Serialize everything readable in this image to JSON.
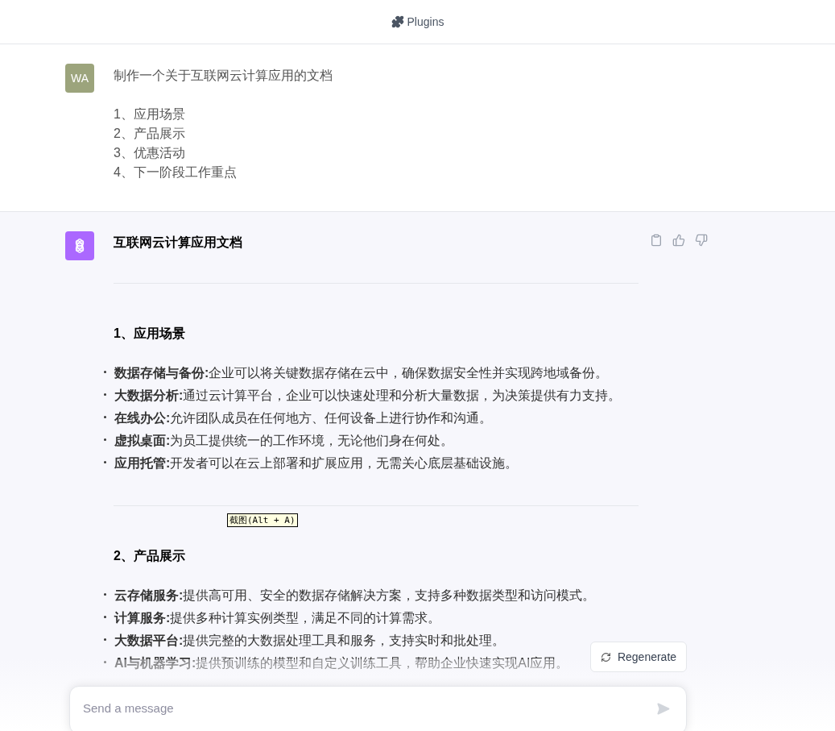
{
  "header": {
    "title": "Plugins"
  },
  "user_message": {
    "avatar": "WA",
    "prompt": "制作一个关于互联网云计算应用的文档",
    "lines": [
      "1、应用场景",
      "2、产品展示",
      "3、优惠活动",
      "4、下一阶段工作重点"
    ]
  },
  "assistant_message": {
    "title": "互联网云计算应用文档",
    "sections": [
      {
        "heading": "1、应用场景",
        "items": [
          "**数据存储与备份:**企业可以将关键数据存储在云中，确保数据安全性并实现跨地域备份。",
          "**大数据分析:**通过云计算平台，企业可以快速处理和分析大量数据，为决策提供有力支持。",
          "**在线办公:**允许团队成员在任何地方、任何设备上进行协作和沟通。",
          "**虚拟桌面:**为员工提供统一的工作环境，无论他们身在何处。",
          "**应用托管:**开发者可以在云上部署和扩展应用，无需关心底层基础设施。"
        ]
      },
      {
        "heading": "2、产品展示",
        "items": [
          "**云存储服务:**提供高可用、安全的数据存储解决方案，支持多种数据类型和访问模式。",
          "**计算服务:**提供多种计算实例类型，满足不同的计算需求。",
          "**大数据平台:**提供完整的大数据处理工具和服务，支持实时和批处理。",
          "**AI与机器学习:**提供预训练的模型和自定义训练工具，帮助企业快速实现AI应用。"
        ]
      }
    ]
  },
  "tooltip": "截图(Alt + A)",
  "regenerate_button": "Regenerate",
  "composer": {
    "placeholder": "Send a message"
  }
}
